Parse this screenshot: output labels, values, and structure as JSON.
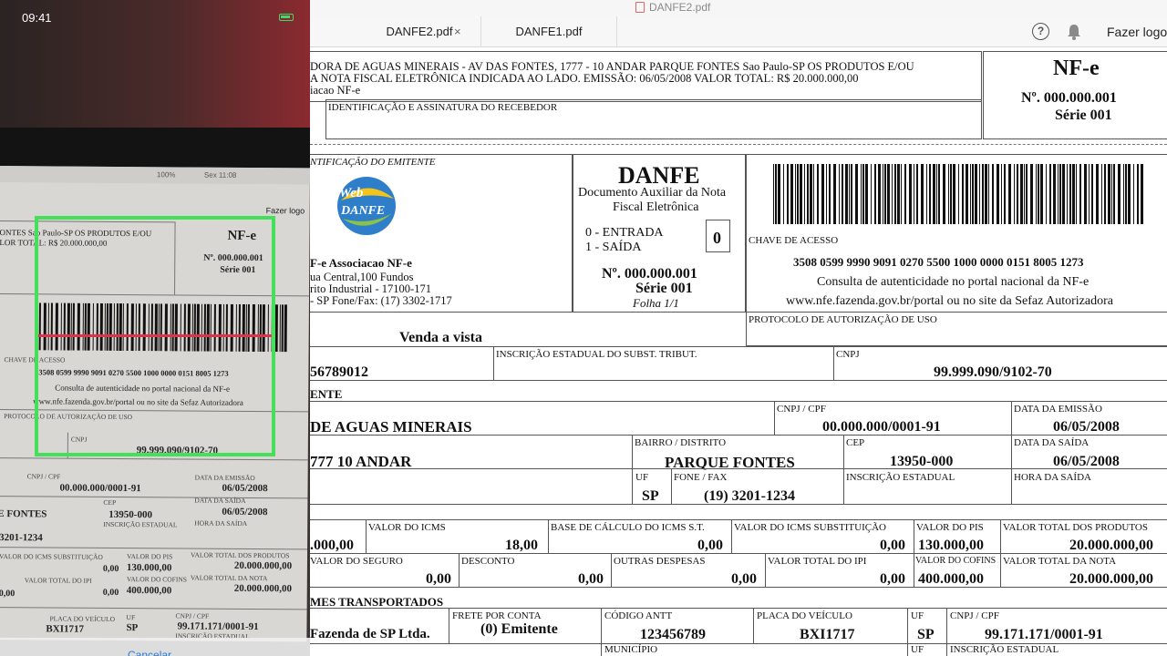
{
  "window": {
    "title": "DANFE2.pdf"
  },
  "tabs": [
    {
      "label": "DANFE2.pdf",
      "close": "×"
    },
    {
      "label": "DANFE1.pdf"
    }
  ],
  "toolbar": {
    "help_icon": "?",
    "logout_label": "Fazer logou"
  },
  "doc": {
    "header_line1": "DORA DE AGUAS MINERAIS - AV DAS FONTES, 1777 - 10 ANDAR PARQUE FONTES Sao Paulo-SP OS PRODUTOS E/OU",
    "header_line2": "A NOTA FISCAL ELETRÔNICA INDICADA AO LADO. EMISSÃO: 06/05/2008 VALOR TOTAL: R$ 20.000.000,00",
    "header_line3": "iacao NF-e",
    "recebedor_label": "IDENTIFICAÇÃO E ASSINATURA DO RECEBEDOR",
    "nfe_title": "NF-e",
    "nfe_number": "Nº. 000.000.001",
    "nfe_serie": "Série 001",
    "emitente_label": "NTIFICAÇÃO DO EMITENTE",
    "logo_line1": "Web",
    "logo_line2": "DANFE",
    "emitente_name": "F-e Associacao NF-e",
    "emitente_addr1": "ua Central,100  Fundos",
    "emitente_addr2": "rito Industrial - 17100-171",
    "emitente_addr3": "- SP Fone/Fax: (17) 3302-1717",
    "danfe_title": "DANFE",
    "danfe_sub1": "Documento Auxiliar da Nota",
    "danfe_sub2": "Fiscal Eletrônica",
    "entrada": "0 - ENTRADA",
    "saida": "1 - SAÍDA",
    "tipo_value": "0",
    "danfe_number": "Nº. 000.000.001",
    "danfe_serie": "Série 001",
    "folha": "Folha 1/1",
    "chave_label": "CHAVE DE ACESSO",
    "chave_value": "3508 0599 9990 9091 0270 5500 1000 0000 0151 8005 1273",
    "consulta_line1": "Consulta de autenticidade no portal nacional da NF-e",
    "consulta_line2": "www.nfe.fazenda.gov.br/portal ou no site da Sefaz Autorizadora",
    "natureza_value": "Venda a vista",
    "protocolo_label": "PROTOCOLO DE AUTORIZAÇÃO DE USO",
    "ie_value": "56789012",
    "ie_subst_label": "INSCRIÇÃO ESTADUAL DO SUBST. TRIBUT.",
    "cnpj_label": "CNPJ",
    "cnpj_value": "99.999.090/9102-70",
    "dest_section": "ENTE",
    "dest_name": "DE AGUAS MINERAIS",
    "dest_cnpj_label": "CNPJ / CPF",
    "dest_cnpj_value": "00.000.000/0001-91",
    "emissao_label": "DATA DA EMISSÃO",
    "emissao_value": "06/05/2008",
    "dest_addr": "777 10 ANDAR",
    "bairro_label": "BAIRRO / DISTRITO",
    "bairro_value": "PARQUE FONTES",
    "cep_label": "CEP",
    "cep_value": "13950-000",
    "saida_label": "DATA DA SAÍDA",
    "saida_value": "06/05/2008",
    "uf_label": "UF",
    "uf_value": "SP",
    "fone_label": "FONE / FAX",
    "fone_value": "(19) 3201-1234",
    "ie_label": "INSCRIÇÃO ESTADUAL",
    "hora_label": "HORA DA SAÍDA",
    "base_icms_value": ".000,00",
    "icms_label": "VALOR DO ICMS",
    "icms_value": "18,00",
    "base_st_label": "BASE DE CÁLCULO DO ICMS S.T.",
    "base_st_value": "0,00",
    "icms_st_label": "VALOR DO ICMS SUBSTITUIÇÃO",
    "icms_st_value": "0,00",
    "pis_label": "VALOR DO PIS",
    "pis_value": "130.000,00",
    "total_prod_label": "VALOR TOTAL DOS PRODUTOS",
    "total_prod_value": "20.000.000,00",
    "seguro_label": "VALOR DO SEGURO",
    "seguro_value": "0,00",
    "desconto_label": "DESCONTO",
    "desconto_value": "0,00",
    "outras_label": "OUTRAS DESPESAS",
    "outras_value": "0,00",
    "ipi_label": "VALOR TOTAL DO IPI",
    "ipi_value": "0,00",
    "cofins_label": "VALOR DO COFINS",
    "cofins_value": "400.000,00",
    "total_nota_label": "VALOR TOTAL DA NOTA",
    "total_nota_value": "20.000.000,00",
    "transp_section": "MES TRANSPORTADOS",
    "transp_name": "Fazenda de SP Ltda.",
    "frete_label": "FRETE POR CONTA",
    "frete_value": "(0) Emitente",
    "antt_label": "CÓDIGO ANTT",
    "antt_value": "123456789",
    "placa_label": "PLACA DO VEÍCULO",
    "placa_value": "BXI1717",
    "t_uf_label": "UF",
    "t_uf_value": "SP",
    "t_cnpj_label": "CNPJ / CPF",
    "t_cnpj_value": "99.171.171/0001-91",
    "municipio_label": "MUNICÍPIO",
    "t_uf2_label": "UF",
    "t_ie_label": "INSCRIÇÃO ESTADUAL"
  },
  "phone": {
    "time": "09:41",
    "mac_clock": "Sex 11:08",
    "mac_battery": "100%",
    "mac_logout": "Fazer logo",
    "p_hdr1": "ONTES Sao Paulo-SP OS PRODUTOS E/OU",
    "p_hdr2": "LOR TOTAL: R$ 20.000.000,00",
    "p_nfe": "NF-e",
    "p_num": "Nº. 000.000.001",
    "p_serie": "Série 001",
    "p_chave_label": "CHAVE DE ACESSO",
    "p_chave": "3508 0599 9990 9091 0270 5500 1000 0000 0151 8005 1273",
    "p_consulta1": "Consulta de autenticidade no portal nacional da NF-e",
    "p_consulta2": "www.nfe.fazenda.gov.br/portal ou no site da Sefaz Autorizadora",
    "p_protocolo": "PROTOCOLO DE AUTORIZAÇÃO DE USO",
    "p_cnpj_label": "CNPJ",
    "p_cnpj": "99.999.090/9102-70",
    "p_dcnpj_label": "CNPJ / CPF",
    "p_dcnpj": "00.000.000/0001-91",
    "p_emissao_label": "DATA DA EMISSÃO",
    "p_emissao": "06/05/2008",
    "p_bairro": "E FONTES",
    "p_cep_label": "CEP",
    "p_cep": "13950-000",
    "p_saida_label": "DATA DA SAÍDA",
    "p_saida": "06/05/2008",
    "p_ie_label": "INSCRIÇÃO ESTADUAL",
    "p_hora_label": "HORA DA SAÍDA",
    "p_fone": "3201-1234",
    "p_icmsst_label": "VALOR DO ICMS SUBSTITUIÇÃO",
    "p_icmsst": "0,00",
    "p_pis_label": "VALOR DO PIS",
    "p_pis": "130.000,00",
    "p_totprod_label": "VALOR TOTAL DOS PRODUTOS",
    "p_totprod": "20.000.000,00",
    "p_ipi_label": "VALOR TOTAL DO IPI",
    "p_ipi": "0,00",
    "p_cofins_label": "VALOR DO COFINS",
    "p_cofins": "400.000,00",
    "p_totnota_label": "VALOR TOTAL DA NOTA",
    "p_totnota": "20.000.000,00",
    "p_zero": "0,00",
    "p_zero2": "0,00",
    "p_placa_label": "PLACA DO VEÍCULO",
    "p_placa": "BXI1717",
    "p_uf_label": "UF",
    "p_uf": "SP",
    "p_tcnpj_label": "CNPJ / CPF",
    "p_tcnpj": "99.171.171/0001-91",
    "p_tie_label": "INSCRIÇÃO ESTADUAL",
    "cancel": "Cancelar"
  },
  "colors": {
    "scan_frame": "#45e05a",
    "scan_line": "#e0334a",
    "battery": "#3ddc6a"
  }
}
